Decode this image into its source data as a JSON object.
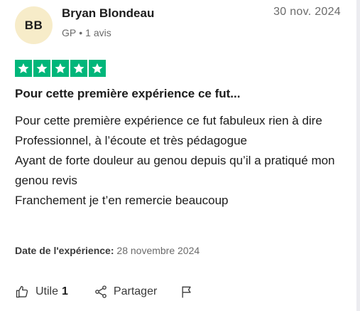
{
  "reviewer": {
    "initials": "BB",
    "name": "Bryan Blondeau",
    "country": "GP",
    "separator": "•",
    "review_count": "1 avis"
  },
  "review": {
    "date": "30 nov. 2024",
    "rating": 5,
    "rating_color": "#00b67a",
    "title": "Pour cette première expérience ce fut...",
    "body_lines": [
      "Pour cette première expérience ce fut fabuleux rien à dire",
      "Professionnel, à l’écoute et très pédagogue",
      "Ayant de forte douleur au genou depuis qu’il a pratiqué mon genou revis",
      "Franchement je t’en remercie beaucoup"
    ],
    "experience_label": "Date de l'expérience:",
    "experience_date": "28 novembre 2024"
  },
  "actions": {
    "useful_label": "Utile",
    "useful_count": "1",
    "share_label": "Partager",
    "icons": [
      "thumbs-up-icon",
      "share-icon",
      "flag-icon"
    ]
  }
}
